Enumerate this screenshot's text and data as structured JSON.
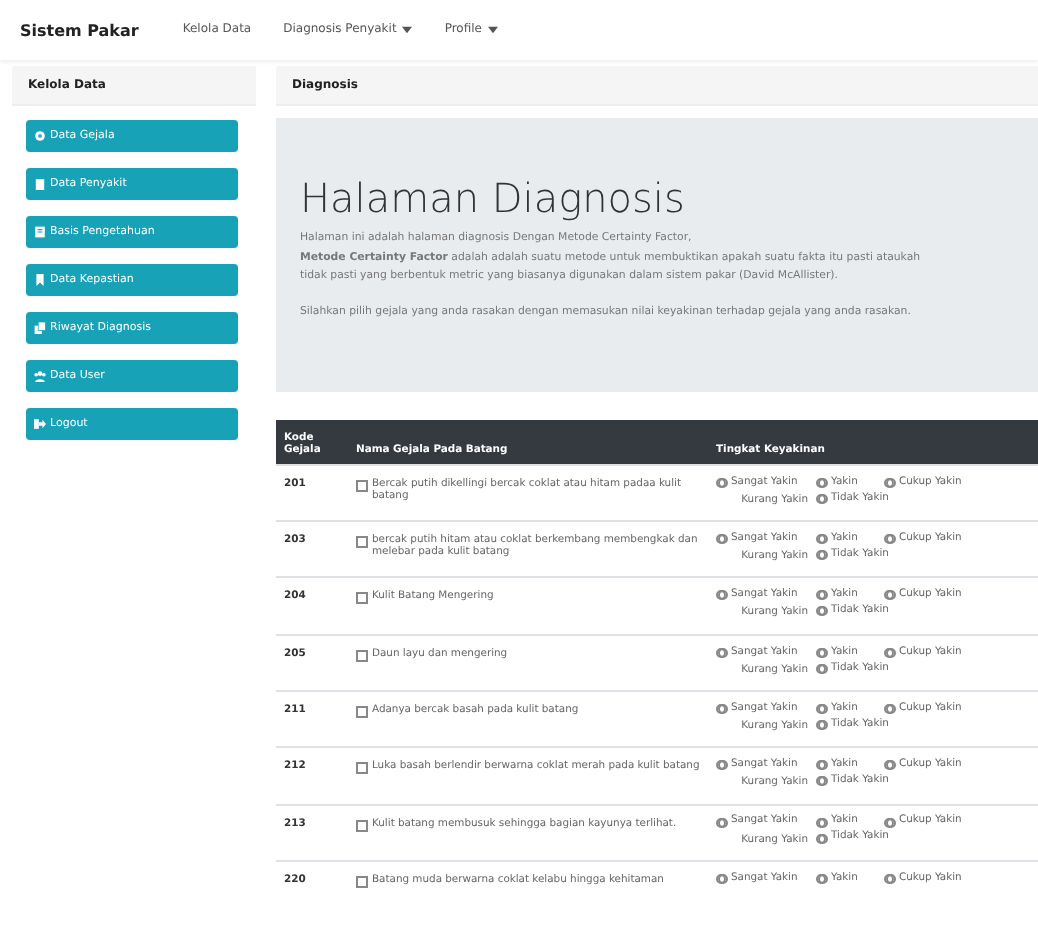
{
  "navbar": {
    "brand": "Sistem Pakar",
    "items": [
      {
        "label": "Kelola Data",
        "dropdown": false
      },
      {
        "label": "Diagnosis Penyakit",
        "dropdown": true
      },
      {
        "label": "Profile",
        "dropdown": true
      }
    ]
  },
  "sidebar": {
    "title": "Kelola Data",
    "items": [
      {
        "label": "Data Gejala"
      },
      {
        "label": "Data Penyakit"
      },
      {
        "label": "Basis Pengetahuan"
      },
      {
        "label": "Data Kepastian"
      },
      {
        "label": "Riwayat Diagnosis"
      },
      {
        "label": "Data User"
      },
      {
        "label": "Logout"
      }
    ]
  },
  "main": {
    "title": "Diagnosis",
    "heading": "Halaman Diagnosis",
    "paragraphs": [
      "Halaman ini adalah halaman diagnosis Dengan Metode Certainty Factor,",
      "**Metode Certainty Factor** adalah adalah suatu metode untuk membuktikan apakah suatu fakta itu pasti ataukah tidak pasti yang berbentuk metric yang biasanya digunakan dalam sistem pakar (David McAllister).",
      "Silahkan pilih gejala yang anda rasakan dengan memasukan nilai keyakinan terhadap gejala yang anda rasakan."
    ]
  },
  "table": {
    "columns": [
      "Kode Gejala",
      "Nama Gejala Pada Batang",
      "Tingkat Keyakinan"
    ],
    "rows": [
      {
        "code": "201",
        "name": "Bercak putih dikellingi bercak coklat atau hitam padaa kulit batang",
        "checked": false,
        "options": [
          {
            "label": "Sangat Yakin",
            "kind": "radio",
            "selected": false
          },
          {
            "label": "Yakin",
            "kind": "radio",
            "selected": false
          },
          {
            "label": "Cukup Yakin",
            "kind": "radio",
            "selected": false
          },
          {
            "label": "Kurang Yakin",
            "kind": "text"
          },
          {
            "label": "Tidak Yakin",
            "kind": "radio",
            "selected": false
          }
        ]
      },
      {
        "code": "203",
        "name": "bercak putih hitam atau coklat berkembang membengkak dan melebar pada kulit batang",
        "checked": false,
        "options": [
          {
            "label": "Sangat Yakin",
            "kind": "radio",
            "selected": false
          },
          {
            "label": "Yakin",
            "kind": "radio",
            "selected": false
          },
          {
            "label": "Cukup Yakin",
            "kind": "radio",
            "selected": false
          },
          {
            "label": "Kurang Yakin",
            "kind": "text"
          },
          {
            "label": "Tidak Yakin",
            "kind": "radio",
            "selected": false
          }
        ]
      },
      {
        "code": "204",
        "name": "Kulit Batang Mengering",
        "checked": false,
        "options": [
          {
            "label": "Sangat Yakin",
            "kind": "radio",
            "selected": false
          },
          {
            "label": "Yakin",
            "kind": "radio",
            "selected": false
          },
          {
            "label": "Cukup Yakin",
            "kind": "radio",
            "selected": false
          },
          {
            "label": "Kurang Yakin",
            "kind": "text"
          },
          {
            "label": "Tidak Yakin",
            "kind": "radio",
            "selected": false
          }
        ]
      },
      {
        "code": "205",
        "name": "Daun layu dan mengering",
        "checked": false,
        "options": [
          {
            "label": "Sangat Yakin",
            "kind": "radio",
            "selected": false
          },
          {
            "label": "Yakin",
            "kind": "radio",
            "selected": false
          },
          {
            "label": "Cukup Yakin",
            "kind": "radio",
            "selected": false
          },
          {
            "label": "Kurang Yakin",
            "kind": "text"
          },
          {
            "label": "Tidak Yakin",
            "kind": "radio",
            "selected": false
          }
        ]
      },
      {
        "code": "211",
        "name": "Adanya bercak basah pada kulit batang",
        "checked": false,
        "options": [
          {
            "label": "Sangat Yakin",
            "kind": "radio",
            "selected": false
          },
          {
            "label": "Yakin",
            "kind": "radio",
            "selected": false
          },
          {
            "label": "Cukup Yakin",
            "kind": "radio",
            "selected": false
          },
          {
            "label": "Kurang Yakin",
            "kind": "text"
          },
          {
            "label": "Tidak Yakin",
            "kind": "radio",
            "selected": false
          }
        ]
      },
      {
        "code": "212",
        "name": "Luka basah berlendir berwarna coklat merah pada kulit batang",
        "checked": false,
        "options": [
          {
            "label": "Sangat Yakin",
            "kind": "radio",
            "selected": false
          },
          {
            "label": "Yakin",
            "kind": "radio",
            "selected": false
          },
          {
            "label": "Cukup Yakin",
            "kind": "radio",
            "selected": false
          },
          {
            "label": "Kurang Yakin",
            "kind": "text"
          },
          {
            "label": "Tidak Yakin",
            "kind": "radio",
            "selected": false
          }
        ]
      },
      {
        "code": "213",
        "name": "Kulit batang membusuk sehingga bagian kayunya terlihat.",
        "checked": false,
        "options": [
          {
            "label": "Sangat Yakin",
            "kind": "radio",
            "selected": false
          },
          {
            "label": "Yakin",
            "kind": "radio",
            "selected": false
          },
          {
            "label": "Cukup Yakin",
            "kind": "radio",
            "selected": false
          },
          {
            "label": "Kurang Yakin",
            "kind": "text"
          },
          {
            "label": "Tidak Yakin",
            "kind": "radio",
            "selected": false
          }
        ]
      },
      {
        "code": "220",
        "name": "Batang muda berwarna coklat kelabu hingga kehitaman",
        "checked": false,
        "options": [
          {
            "label": "Sangat Yakin",
            "kind": "radio",
            "selected": false
          },
          {
            "label": "Yakin",
            "kind": "radio",
            "selected": false
          },
          {
            "label": "Cukup Yakin",
            "kind": "radio",
            "selected": false
          }
        ]
      }
    ]
  }
}
